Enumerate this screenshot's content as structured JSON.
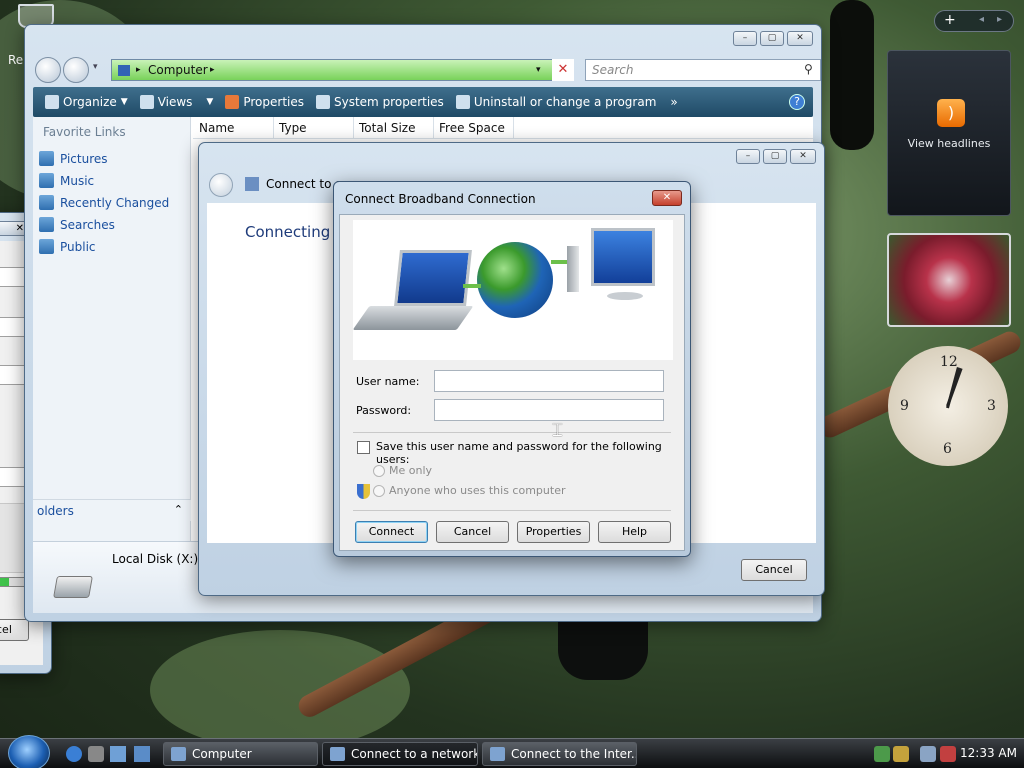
{
  "desktop": {
    "recycle_label": "Re"
  },
  "explorer": {
    "address": "Computer",
    "search_placeholder": "Search",
    "toolbar": [
      "Organize",
      "Views",
      "Properties",
      "System properties",
      "Uninstall or change a program"
    ],
    "toolbar_more": "»",
    "favorites_heading": "Favorite Links",
    "favorites": [
      "Pictures",
      "Music",
      "Recently Changed",
      "Searches",
      "Public"
    ],
    "columns": [
      "Name",
      "Type",
      "Total Size",
      "Free Space"
    ],
    "folders_label": "olders",
    "drive_label": "Local Disk (X:)"
  },
  "leftwin": {
    "button_label": "cel"
  },
  "connect_window": {
    "title": "Connect to a network",
    "title_visible": "Connect to a",
    "heading": "Connecting t",
    "cancel": "Cancel"
  },
  "dialog": {
    "title": "Connect Broadband Connection",
    "username_label": "User name:",
    "password_label": "Password:",
    "username_value": "",
    "password_value": "",
    "save_label": "Save this user name and password for the following users:",
    "me_only": "Me only",
    "anyone": "Anyone who uses this computer",
    "buttons": {
      "connect": "Connect",
      "cancel": "Cancel",
      "properties": "Properties",
      "help": "Help"
    }
  },
  "sidebar": {
    "view_headlines": "View headlines"
  },
  "taskbar": {
    "tasks": [
      "Computer",
      "Connect to a network",
      "Connect to the Inter..."
    ],
    "clock": "12:33 AM"
  }
}
